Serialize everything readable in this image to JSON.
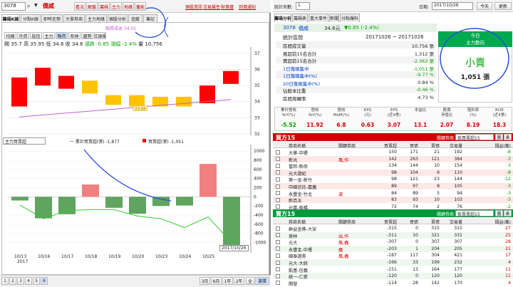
{
  "left": {
    "toolbar": {
      "code": "3078",
      "name": "僑威",
      "buttons": [
        "看法",
        "解盤",
        "籌碼",
        "主力",
        "地緣",
        "蓄能"
      ],
      "links": [
        "個股資訊",
        "交易屬性",
        "財事曆",
        "到價通知"
      ]
    },
    "tabs": [
      "籌碼K線",
      "分點K線",
      "即時走勢",
      "大單券商",
      "主力地緣",
      "個股分析",
      "追蹤",
      "筆記"
    ],
    "subtabs": [
      "均線",
      "外資",
      "投信",
      "主力",
      "融資",
      "布林",
      "趨勢",
      "紅綠陽"
    ],
    "cost_label": "融資成本 34.01",
    "ohlc": {
      "o_label": "開",
      "o": "35.7",
      "h_label": "高",
      "h": "35.95",
      "l_label": "低",
      "l": "34.6",
      "c_label": "收",
      "c": "34.6",
      "v_label": "量",
      "v": "10,756",
      "chg_label": "漲跌",
      "chg": "-0.85",
      "pct_label": "漲幅",
      "pct": "-2.4%"
    },
    "price_ticks": [
      "37",
      "36",
      "35",
      "34",
      "33",
      "32"
    ],
    "price_marker": "31.99",
    "cost_tag": "33.88",
    "candles": [
      {
        "date": "10/13",
        "o": 35.5,
        "c": 33.7,
        "h": 35.5,
        "l": 33.7
      },
      {
        "date": "10/16",
        "o": 35.0,
        "c": 36.1,
        "h": 36.1,
        "l": 35.0
      },
      {
        "date": "10/17",
        "o": 34.8,
        "c": 35.6,
        "h": 35.6,
        "l": 34.8
      },
      {
        "date": "10/18",
        "o": 35.3,
        "c": 34.5,
        "h": 35.3,
        "l": 34.5
      },
      {
        "date": "10/19",
        "o": 34.4,
        "c": 33.8,
        "h": 34.4,
        "l": 33.8
      },
      {
        "date": "10/20",
        "o": 34.4,
        "c": 33.7,
        "h": 34.4,
        "l": 33.7
      },
      {
        "date": "10/23",
        "o": 34.3,
        "c": 33.7,
        "h": 34.3,
        "l": 33.7
      },
      {
        "date": "10/24",
        "o": 34.3,
        "c": 33.7,
        "h": 34.3,
        "l": 33.7
      },
      {
        "date": "10/25",
        "o": 33.9,
        "c": 35.0,
        "h": 35.0,
        "l": 33.9
      },
      {
        "date": "10/26",
        "o": 35.1,
        "c": 35.9,
        "h": 35.9,
        "l": 35.1
      }
    ],
    "indicator": {
      "select": "主力買賣超",
      "legend1": "一 累計買賣超(張) -1,877",
      "legend2": "買賣超(張) -1,051",
      "ticks": [
        "1000",
        "800",
        "600",
        "400",
        "200",
        "0",
        "-200",
        "-400",
        "-600",
        "-800",
        "-1000"
      ],
      "bars": [
        -80,
        -470,
        -380,
        270,
        -240,
        -370,
        -200,
        -190,
        720,
        -1051
      ],
      "line": [
        -180,
        -480,
        -300,
        -280,
        -280,
        -420,
        -480,
        -670,
        -440,
        -1000
      ]
    },
    "x_dates": [
      "10/13",
      "10/16",
      "10/17",
      "10/18",
      "10/19",
      "10/20",
      "10/23",
      "10/24",
      "10/25"
    ],
    "year": "2017",
    "current_date": "2017/10/26",
    "bottom": {
      "pages": [
        "1",
        "2",
        "3",
        "4",
        "5",
        "6"
      ],
      "periods": [
        "3月",
        "6月",
        "1年",
        "2年"
      ],
      "extra": [
        "全",
        "選擇"
      ]
    }
  },
  "right": {
    "header": {
      "days_label": "統計天數:",
      "days": "1",
      "date_label": "日期:",
      "date": "2017/10/26",
      "prev": "今天",
      "refresh": "更新"
    },
    "tabs": [
      "籌碼分析",
      "籌碼表",
      "重大事件",
      "新聞",
      "分點爆料"
    ],
    "stock": {
      "code": "3078",
      "name": "僑威",
      "price": "34.6元",
      "change": "▼0.85 (-2.4%)"
    },
    "range_label": "統計區間",
    "range": "20171026 ~ 20171026",
    "stats": [
      {
        "label": "區間成交量",
        "value": "10,756 張"
      },
      {
        "label": "買超前15名合計",
        "value": "1,312 張"
      },
      {
        "label": "賣超前15名合計",
        "value": "-2,363 張"
      },
      {
        "label": "1日籌碼集中",
        "value": "-1,051 張"
      },
      {
        "label": "1日籌碼集中(%)",
        "value": "-9.77 %"
      },
      {
        "label": "20日籌碼集中(%)",
        "value": "0.84 %"
      },
      {
        "label": "佔股本比重",
        "value": "-0.46 %"
      },
      {
        "label": "區間周轉率",
        "value": "4.73 %"
      }
    ],
    "today": {
      "label": "今日",
      "sub": "主力動向",
      "verdict": "小賣",
      "amount": "1,051 張"
    },
    "metrics_h": [
      "累計營收\nYoY(%)",
      "營收\nYoY(%)",
      "營收\nMoM(%)",
      "EPS\n(元)",
      "EPS\n(近4季)",
      "本益比",
      "股價\n淨值比",
      "殖利率\n(%)",
      "ROE\n(近4季)"
    ],
    "metrics_v": [
      "-5.52",
      "11.92",
      "6.8",
      "0.63",
      "3.07",
      "13.1",
      "2.07",
      "8.19",
      "18.3"
    ],
    "buy": {
      "title": "買方15",
      "tag": "關鍵券商",
      "select": "依買賣超15",
      "btn1": "圖",
      "btn2": "表",
      "cols": [
        "券商名稱",
        "關鍵券商",
        "買賣超",
        "買張",
        "賣張",
        "交易量",
        "損益(萬)"
      ],
      "rows": [
        [
          "大華-中壢",
          "",
          "150",
          "171",
          "21",
          "192",
          "-8"
        ],
        [
          "新光",
          "風,作",
          "142",
          "263",
          "121",
          "384",
          "-3"
        ],
        [
          "富邦-新南",
          "",
          "134",
          "144",
          "10",
          "154",
          "-3"
        ],
        [
          "元大證紀",
          "",
          "98",
          "104",
          "6",
          "110",
          "-8"
        ],
        [
          "第一金-新竹",
          "",
          "98",
          "121",
          "23",
          "144",
          "-12"
        ],
        [
          "中國信託-嘉義",
          "",
          "89",
          "97",
          "8",
          "105",
          "-3"
        ],
        [
          "永豐金-竹北",
          "波",
          "84",
          "89",
          "5",
          "94",
          "-3"
        ],
        [
          "新百王",
          "",
          "83",
          "93",
          "10",
          "103",
          "-3"
        ],
        [
          "元富-板橋",
          "",
          "72",
          "74",
          "2",
          "76",
          "-2"
        ]
      ]
    },
    "sell": {
      "title": "賣方15",
      "tag": "關鍵券商",
      "select": "依賣賣超15",
      "btn1": "圖",
      "btn2": "表",
      "cols": [
        "券商名稱",
        "關鍵券商",
        "買賣超",
        "買張",
        "賣張",
        "交易量",
        "損益(萬)"
      ],
      "rows": [
        [
          "群益金鼎-大安",
          "",
          "-315",
          "0",
          "315",
          "315",
          "27"
        ],
        [
          "美林",
          "出,作",
          "-311",
          "10",
          "321",
          "331",
          "25"
        ],
        [
          "元大",
          "風,蟲",
          "-307",
          "0",
          "307",
          "307",
          "28"
        ],
        [
          "永豐金-中壢",
          "蟲",
          "-203",
          "1",
          "204",
          "205",
          "21"
        ],
        [
          "國泰證券",
          "風,蟲",
          "-187",
          "117",
          "304",
          "421",
          "17"
        ],
        [
          "元大-大統",
          "",
          "-166",
          "33",
          "199",
          "232",
          "4"
        ],
        [
          "凱基-信義",
          "",
          "-151",
          "13",
          "164",
          "177",
          "11"
        ],
        [
          "統一-仁愛",
          "",
          "-120",
          "0",
          "120",
          "120",
          "11"
        ],
        [
          "開發",
          "",
          "-114",
          "28",
          "142",
          "170",
          "4"
        ]
      ]
    }
  },
  "colors": {
    "red_candle": "#ff0000",
    "yellow_candle": "#ffc400",
    "buy_header": "#d40000",
    "sell_header": "#009a3a",
    "ma_line": "#c060d0"
  }
}
